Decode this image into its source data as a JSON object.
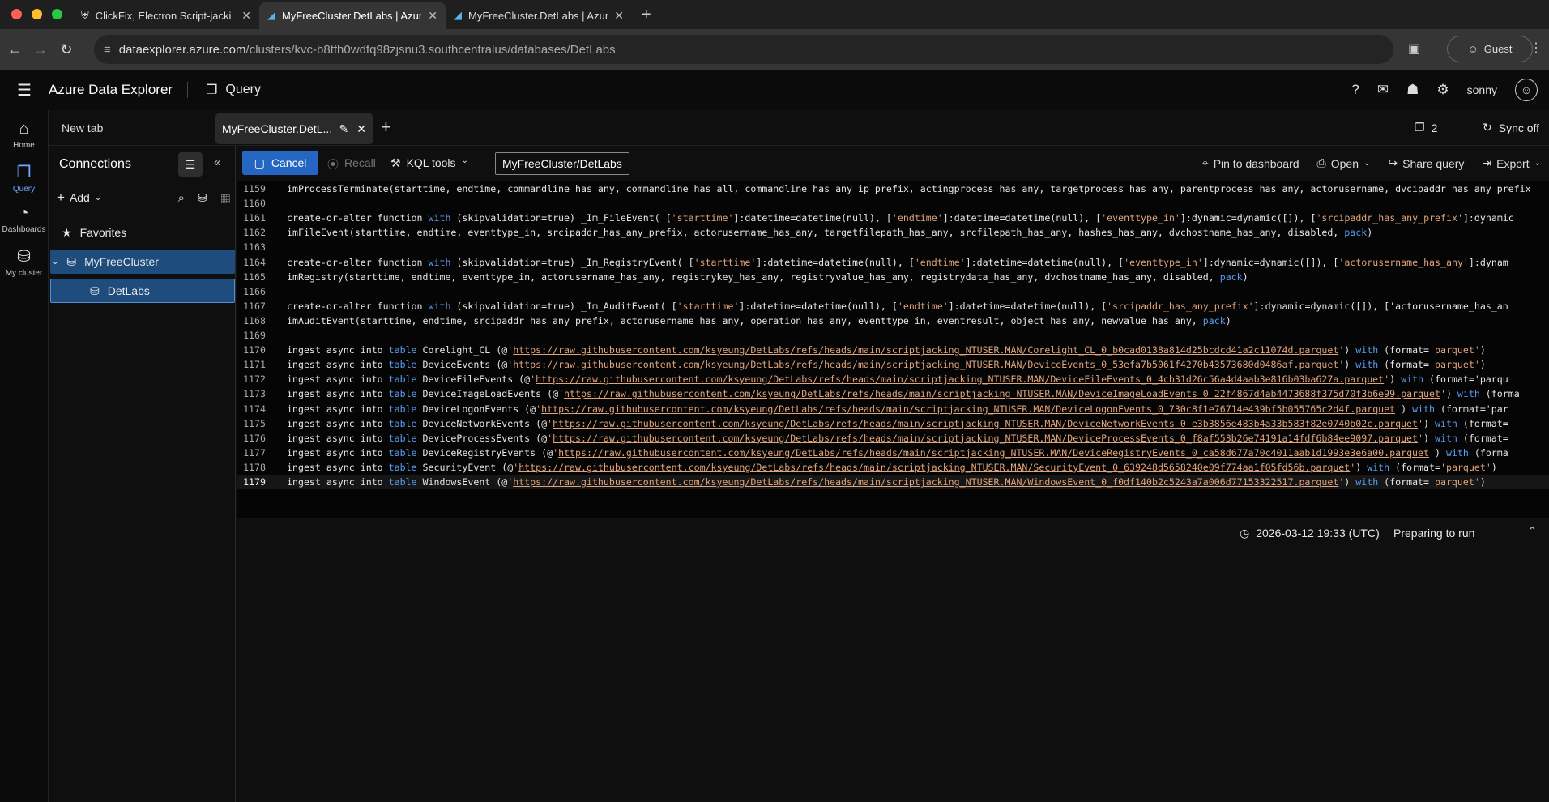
{
  "browser": {
    "tabs": [
      {
        "title": "ClickFix, Electron Script-jacki",
        "icon": "shield-icon"
      },
      {
        "title": "MyFreeCluster.DetLabs | Azur",
        "icon": "adx-icon"
      },
      {
        "title": "MyFreeCluster.DetLabs | Azur",
        "icon": "adx-icon"
      }
    ],
    "url_host": "dataexplorer.azure.com",
    "url_path": "/clusters/kvc-b8tfh0wdfq98zjsnu3.southcentralus/databases/DetLabs",
    "profile": "Guest"
  },
  "app": {
    "title": "Azure Data Explorer",
    "section": "Query",
    "user": "sonny"
  },
  "rail": [
    {
      "label": "Home",
      "icon": "home-icon"
    },
    {
      "label": "Query",
      "icon": "query-icon"
    },
    {
      "label": "Dashboards",
      "icon": "dashboard-icon"
    },
    {
      "label": "My cluster",
      "icon": "cluster-icon"
    }
  ],
  "query_tabs": {
    "new_tab": "New tab",
    "active": "MyFreeCluster.DetL...",
    "count": "2",
    "sync": "Sync off"
  },
  "connections": {
    "title": "Connections",
    "add": "Add",
    "favorites": "Favorites",
    "cluster": "MyFreeCluster",
    "database": "DetLabs"
  },
  "toolbar": {
    "cancel": "Cancel",
    "recall": "Recall",
    "kql_tools": "KQL tools",
    "scope": "MyFreeCluster/DetLabs",
    "pin": "Pin to dashboard",
    "open": "Open",
    "share": "Share query",
    "export": "Export"
  },
  "editor_lines": [
    {
      "n": "1159",
      "text": "imProcessTerminate(starttime, endtime, commandline_has_any, commandline_has_all, commandline_has_any_ip_prefix, actingprocess_has_any, targetprocess_has_any, parentprocess_has_any, actorusername, dvcipaddr_has_any_prefix"
    },
    {
      "n": "1160",
      "text": ""
    },
    {
      "n": "1161",
      "text": "create-or-alter function with (skipvalidation=true) _Im_FileEvent( ['starttime']:datetime=datetime(null), ['endtime']:datetime=datetime(null), ['eventtype_in']:dynamic=dynamic([]), ['srcipaddr_has_any_prefix']:dynamic"
    },
    {
      "n": "1162",
      "text": "imFileEvent(starttime, endtime, eventtype_in, srcipaddr_has_any_prefix, actorusername_has_any, targetfilepath_has_any, srcfilepath_has_any, hashes_has_any, dvchostname_has_any, disabled, pack)"
    },
    {
      "n": "1163",
      "text": ""
    },
    {
      "n": "1164",
      "text": "create-or-alter function with (skipvalidation=true) _Im_RegistryEvent( ['starttime']:datetime=datetime(null), ['endtime']:datetime=datetime(null), ['eventtype_in']:dynamic=dynamic([]), ['actorusername_has_any']:dynam"
    },
    {
      "n": "1165",
      "text": "imRegistry(starttime, endtime, eventtype_in, actorusername_has_any, registrykey_has_any, registryvalue_has_any, registrydata_has_any, dvchostname_has_any, disabled, pack)"
    },
    {
      "n": "1166",
      "text": ""
    },
    {
      "n": "1167",
      "text": "create-or-alter function with (skipvalidation=true) _Im_AuditEvent( ['starttime']:datetime=datetime(null), ['endtime']:datetime=datetime(null), ['srcipaddr_has_any_prefix']:dynamic=dynamic([]), ['actorusername_has_an"
    },
    {
      "n": "1168",
      "text": "imAuditEvent(starttime, endtime, srcipaddr_has_any_prefix, actorusername_has_any, operation_has_any, eventtype_in, eventresult, object_has_any, newvalue_has_any, pack)"
    },
    {
      "n": "1169",
      "text": ""
    },
    {
      "n": "1170",
      "text": "ingest async into table Corelight_CL (@'https://raw.githubusercontent.com/ksyeung/DetLabs/refs/heads/main/scriptjacking_NTUSER.MAN/Corelight_CL_0_b0cad0138a814d25bcdcd41a2c11074d.parquet') with (format='parquet')"
    },
    {
      "n": "1171",
      "text": "ingest async into table DeviceEvents (@'https://raw.githubusercontent.com/ksyeung/DetLabs/refs/heads/main/scriptjacking_NTUSER.MAN/DeviceEvents_0_53efa7b5061f4270b43573680d0486af.parquet') with (format='parquet')"
    },
    {
      "n": "1172",
      "text": "ingest async into table DeviceFileEvents (@'https://raw.githubusercontent.com/ksyeung/DetLabs/refs/heads/main/scriptjacking_NTUSER.MAN/DeviceFileEvents_0_4cb31d26c56a4d4aab3e816b03ba627a.parquet') with (format='parqu"
    },
    {
      "n": "1173",
      "text": "ingest async into table DeviceImageLoadEvents (@'https://raw.githubusercontent.com/ksyeung/DetLabs/refs/heads/main/scriptjacking_NTUSER.MAN/DeviceImageLoadEvents_0_22f4867d4ab4473688f375d70f3b6e99.parquet') with (forma"
    },
    {
      "n": "1174",
      "text": "ingest async into table DeviceLogonEvents (@'https://raw.githubusercontent.com/ksyeung/DetLabs/refs/heads/main/scriptjacking_NTUSER.MAN/DeviceLogonEvents_0_730c8f1e76714e439bf5b055765c2d4f.parquet') with (format='par"
    },
    {
      "n": "1175",
      "text": "ingest async into table DeviceNetworkEvents (@'https://raw.githubusercontent.com/ksyeung/DetLabs/refs/heads/main/scriptjacking_NTUSER.MAN/DeviceNetworkEvents_0_e3b3856e483b4a33b583f82e0740b02c.parquet') with (format="
    },
    {
      "n": "1176",
      "text": "ingest async into table DeviceProcessEvents (@'https://raw.githubusercontent.com/ksyeung/DetLabs/refs/heads/main/scriptjacking_NTUSER.MAN/DeviceProcessEvents_0_f8af553b26e74191a14fdf6b84ee9097.parquet') with (format="
    },
    {
      "n": "1177",
      "text": "ingest async into table DeviceRegistryEvents (@'https://raw.githubusercontent.com/ksyeung/DetLabs/refs/heads/main/scriptjacking_NTUSER.MAN/DeviceRegistryEvents_0_ca58d677a70c4011aab1d1993e3e6a00.parquet') with (forma"
    },
    {
      "n": "1178",
      "text": "ingest async into table SecurityEvent (@'https://raw.githubusercontent.com/ksyeung/DetLabs/refs/heads/main/scriptjacking_NTUSER.MAN/SecurityEvent_0_639248d5658240e09f774aa1f05fd56b.parquet') with (format='parquet')"
    },
    {
      "n": "1179",
      "text": "ingest async into table WindowsEvent (@'https://raw.githubusercontent.com/ksyeung/DetLabs/refs/heads/main/scriptjacking_NTUSER.MAN/WindowsEvent_0_f0df140b2c5243a7a006d77153322517.parquet') with (format='parquet')"
    }
  ],
  "results": {
    "timestamp": "2026-03-12 19:33 (UTC)",
    "status": "Preparing to run"
  }
}
